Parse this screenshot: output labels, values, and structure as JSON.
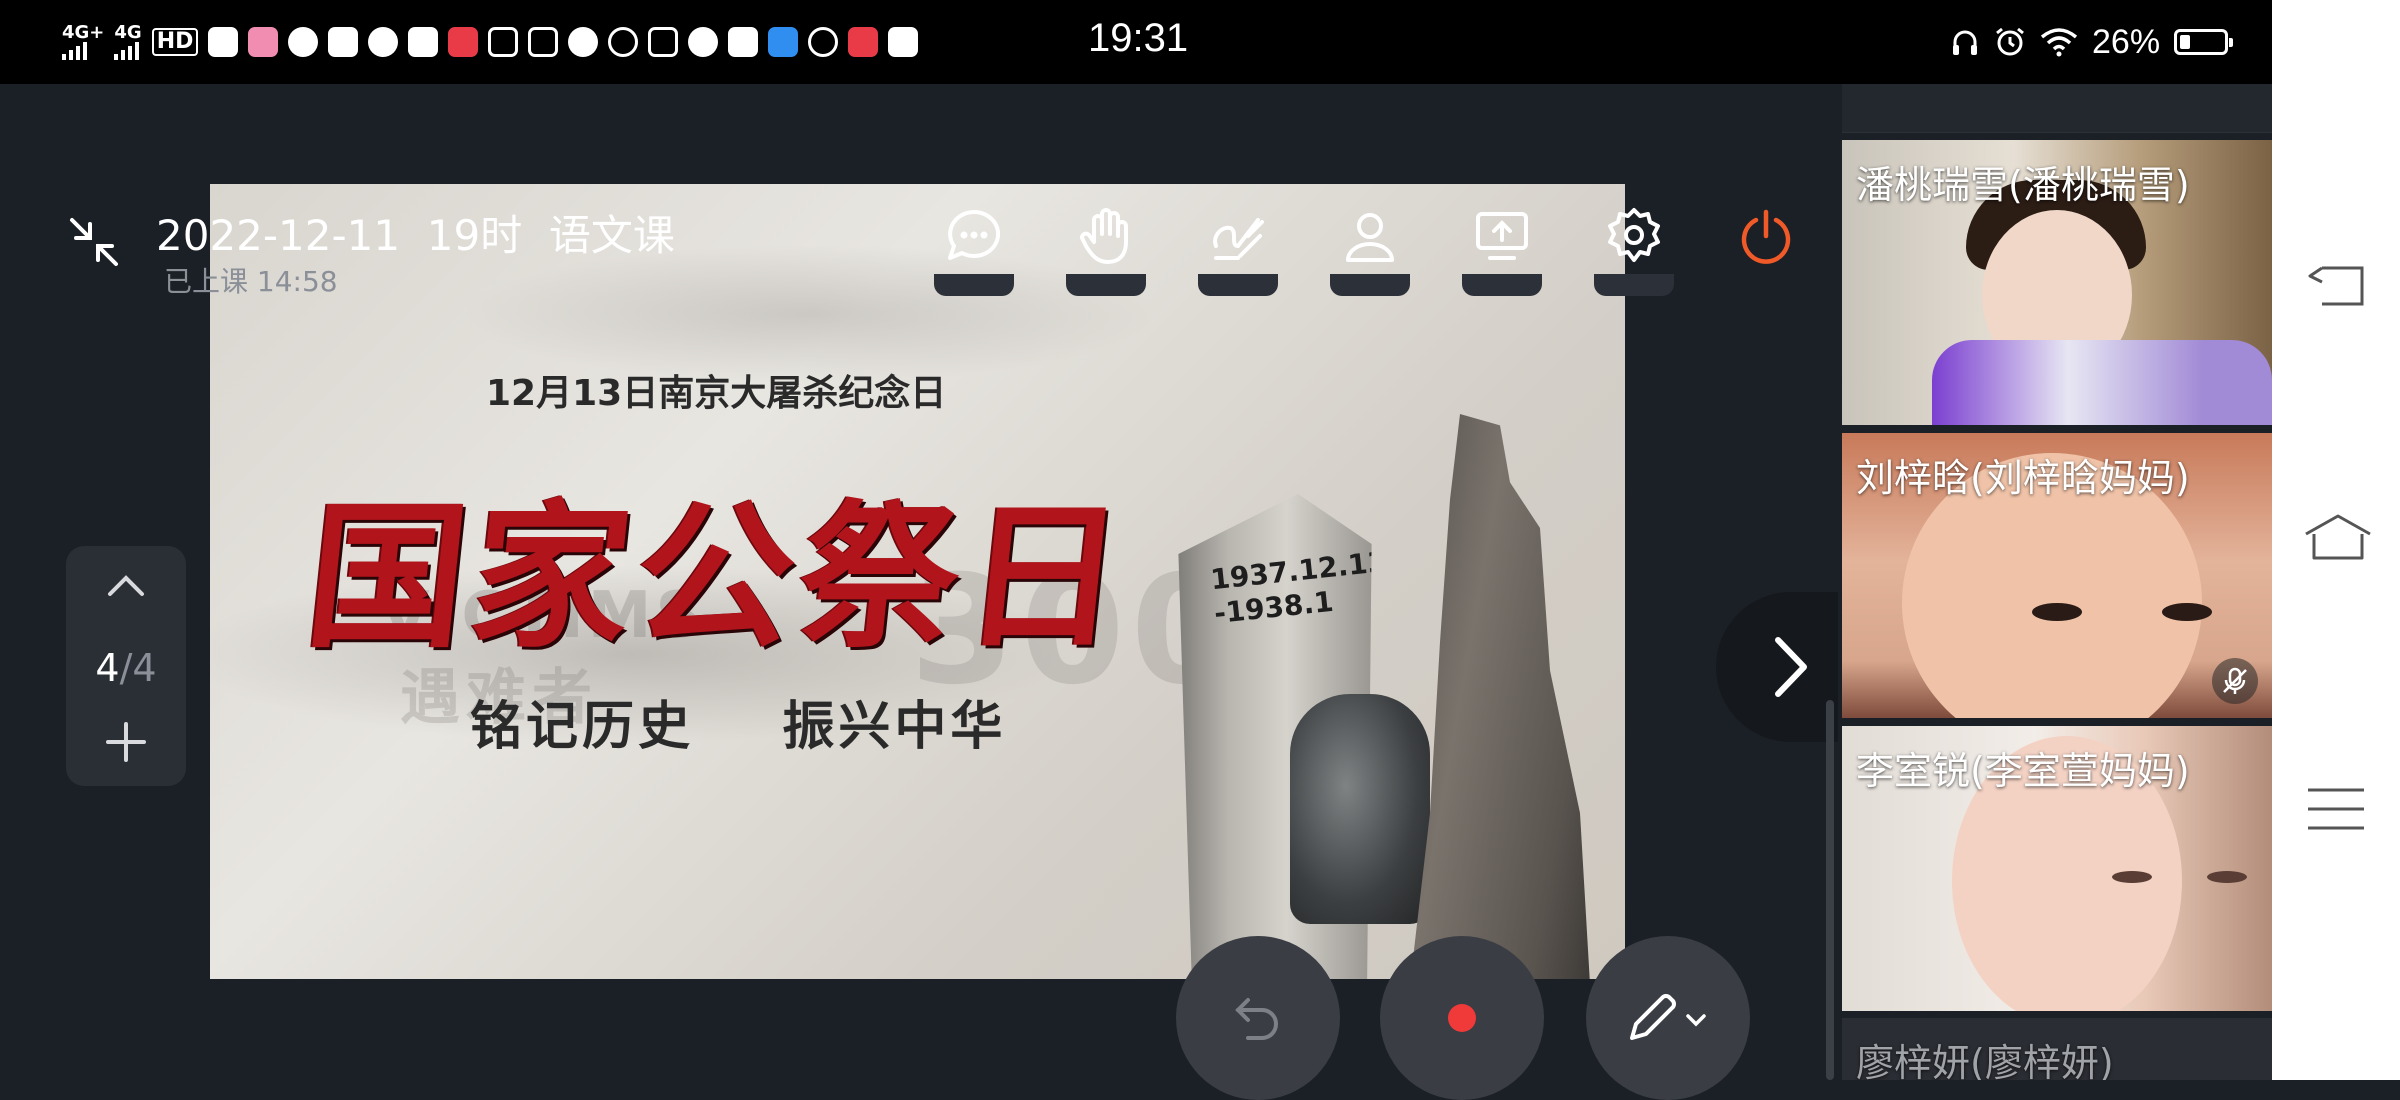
{
  "status_bar": {
    "signal1_label": "4G+",
    "signal2_label": "4G",
    "hd_label": "HD",
    "time": "19:31",
    "battery_percent": "26%",
    "icons": [
      "telegram-icon",
      "app-icon",
      "wechat-icon",
      "video-icon",
      "qq-icon",
      "app-icon",
      "app-icon",
      "app-icon",
      "app-icon",
      "compass-icon",
      "tiktok-icon",
      "app-icon",
      "app-icon",
      "mail-icon",
      "app-icon",
      "app-icon",
      "tiktok-lite-icon",
      "app-icon"
    ]
  },
  "meeting": {
    "title": "2022-12-11  19时  语文课",
    "elapsed": "已上课  14:58"
  },
  "toolbar": {
    "items": [
      "chat-icon",
      "raise-hand-icon",
      "annotate-icon",
      "participants-icon",
      "share-screen-icon",
      "settings-icon",
      "power-icon"
    ],
    "accent_power": "#f05a28"
  },
  "slide": {
    "subtitle": "12月13日南京大屠杀纪念日",
    "title": "国家公祭日",
    "motto": "铭记历史    振兴中华",
    "bg_text_en": "VICTIMS",
    "bg_text_cn": "遇难者",
    "bg_digits": "3000",
    "monument_text": "1937.12.13 -1938.1"
  },
  "page_nav": {
    "current": "4",
    "total": "/4"
  },
  "participants": [
    {
      "name": "潘桃瑞雪(潘桃瑞雪)",
      "muted": false
    },
    {
      "name": "刘梓晗(刘梓晗妈妈)",
      "muted": true
    },
    {
      "name": "李室锐(李室萱妈妈)",
      "muted": false
    },
    {
      "name": "廖梓妍(廖梓妍)",
      "muted": false
    }
  ],
  "controls": {
    "undo": "undo-icon",
    "record": "record-icon",
    "pen": "pen-icon",
    "record_color": "#f03a3a"
  }
}
